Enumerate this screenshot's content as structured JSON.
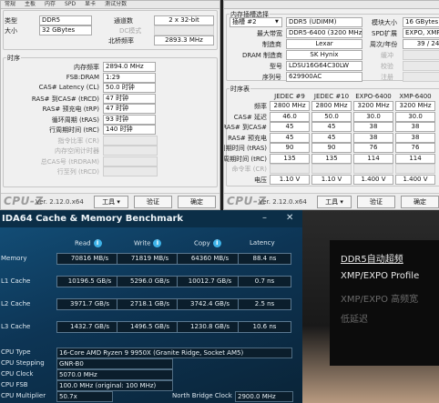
{
  "cpuz_left": {
    "tabs": [
      "常规",
      "主板",
      "内存",
      "SPD",
      "显卡",
      "测试分数"
    ],
    "general": {
      "type_label": "类型",
      "type_value": "DDR5",
      "size_label": "大小",
      "size_value": "32 GBytes",
      "channels_label": "通道数",
      "channels_value": "2 x 32-bit",
      "dc_label": "DC模式",
      "nb_freq_label": "北桥频率",
      "nb_freq_value": "2893.3 MHz"
    },
    "timing": {
      "group_label": "时序",
      "rows": [
        {
          "label": "内存频率",
          "value": "2894.0 MHz",
          "dim": false
        },
        {
          "label": "FSB:DRAM",
          "value": "1:29",
          "dim": false
        },
        {
          "label": "CAS# Latency (CL)",
          "value": "50.0 时钟",
          "dim": false
        },
        {
          "label": "RAS# 到CAS# (tRCD)",
          "value": "47 时钟",
          "dim": false
        },
        {
          "label": "RAS# 预充电 (tRP)",
          "value": "47 时钟",
          "dim": false
        },
        {
          "label": "循环周期 (tRAS)",
          "value": "93 时钟",
          "dim": false
        },
        {
          "label": "行周期时间 (tRC)",
          "value": "140 时钟",
          "dim": false
        },
        {
          "label": "指令比率 (CR)",
          "value": "",
          "dim": true
        },
        {
          "label": "内存空闲计时器",
          "value": "",
          "dim": true
        },
        {
          "label": "总CAS号 (tRDRAM)",
          "value": "",
          "dim": true
        },
        {
          "label": "行至列 (tRCD)",
          "value": "",
          "dim": true
        }
      ]
    },
    "footer": {
      "brand": "CPU-Z",
      "version": "Ver. 2.12.0.x64",
      "tools": "工具",
      "validate": "验证",
      "ok": "确定"
    }
  },
  "cpuz_right": {
    "slot_group_label": "内存插槽选择",
    "slot_value": "插槽 #2",
    "module_type": "DDR5 (UDIMM)",
    "module_size_label": "模块大小",
    "module_size_value": "16 GBytes",
    "max_bw_label": "最大带宽",
    "max_bw_value": "DDR5-6400 (3200 MHz)",
    "spd_ext_label": "SPD扩展",
    "spd_ext_value": "EXPO, XMP 3",
    "maker_label": "制造商",
    "maker_value": "Lexar",
    "week_year_label": "周次/年份",
    "week_year_value": "39 / 24",
    "dram_maker_label": "DRAM 制造商",
    "dram_maker_value": "SK Hynix",
    "buffered_label": "缓冲",
    "part_label": "型号",
    "part_value": "LDSU16G64C30LW",
    "correction_label": "校验",
    "serial_label": "序列号",
    "serial_value": "629900AC",
    "registered_label": "注册",
    "timing_group_label": "时序表",
    "timing_headers": [
      "JEDEC #9",
      "JEDEC #10",
      "EXPO-6400",
      "XMP-6400"
    ],
    "timing_rows": [
      {
        "label": "频率",
        "values": [
          "2800 MHz",
          "2800 MHz",
          "3200 MHz",
          "3200 MHz"
        ]
      },
      {
        "label": "CAS# 延迟",
        "values": [
          "46.0",
          "50.0",
          "30.0",
          "30.0"
        ]
      },
      {
        "label": "RAS# 到CAS#",
        "values": [
          "45",
          "45",
          "38",
          "38"
        ]
      },
      {
        "label": "RAS# 预充电",
        "values": [
          "45",
          "45",
          "38",
          "38"
        ]
      },
      {
        "label": "周期时间 (tRAS)",
        "values": [
          "90",
          "90",
          "76",
          "76"
        ]
      },
      {
        "label": "行周期时间 (tRC)",
        "values": [
          "135",
          "135",
          "114",
          "114"
        ]
      },
      {
        "label": "命令率 (CR)",
        "values": [
          "",
          "",
          "",
          ""
        ]
      },
      {
        "label": "电压",
        "values": [
          "1.10 V",
          "1.10 V",
          "1.400 V",
          "1.400 V"
        ]
      }
    ],
    "footer": {
      "brand": "CPU-Z",
      "version": "Ver. 2.12.0.x64",
      "tools": "工具",
      "validate": "验证",
      "ok": "确定"
    }
  },
  "aida": {
    "title": "IDA64 Cache & Memory Benchmark",
    "headers": {
      "read": "Read",
      "write": "Write",
      "copy": "Copy",
      "latency": "Latency"
    },
    "rows": [
      {
        "label": "Memory",
        "read": "70816 MB/s",
        "write": "71819 MB/s",
        "copy": "64360 MB/s",
        "latency": "88.4 ns"
      },
      {
        "label": "L1 Cache",
        "read": "10196.5 GB/s",
        "write": "5296.0 GB/s",
        "copy": "10012.7 GB/s",
        "latency": "0.7 ns"
      },
      {
        "label": "L2 Cache",
        "read": "3971.7 GB/s",
        "write": "2718.1 GB/s",
        "copy": "3742.4 GB/s",
        "latency": "2.5 ns"
      },
      {
        "label": "L3 Cache",
        "read": "1432.7 GB/s",
        "write": "1496.5 GB/s",
        "copy": "1230.8 GB/s",
        "latency": "10.6 ns"
      }
    ],
    "system": [
      {
        "label": "CPU Type",
        "value": "16-Core AMD Ryzen 9 9950X  (Granite Ridge, Socket AM5)"
      },
      {
        "label": "CPU Stepping",
        "value": "GNR-B0"
      },
      {
        "label": "CPU Clock",
        "value": "5070.0 MHz"
      },
      {
        "label": "CPU FSB",
        "value": "100.0 MHz  (original: 100 MHz)"
      },
      {
        "label": "CPU Multiplier",
        "value": "50.7x"
      }
    ],
    "nb_clock_label": "North Bridge Clock",
    "nb_clock_value": "2900.0 MHz"
  },
  "menu": {
    "items": [
      {
        "label": "DDR5自动超频",
        "state": "selected"
      },
      {
        "label": "XMP/EXPO Profile",
        "state": "normal"
      },
      {
        "label": "XMP/EXPO 高频宽",
        "state": "disabled"
      },
      {
        "label": "低延迟",
        "state": "disabled"
      }
    ],
    "colors": {
      "normal": "#e6e6e6",
      "disabled": "#6a6a6a"
    }
  }
}
